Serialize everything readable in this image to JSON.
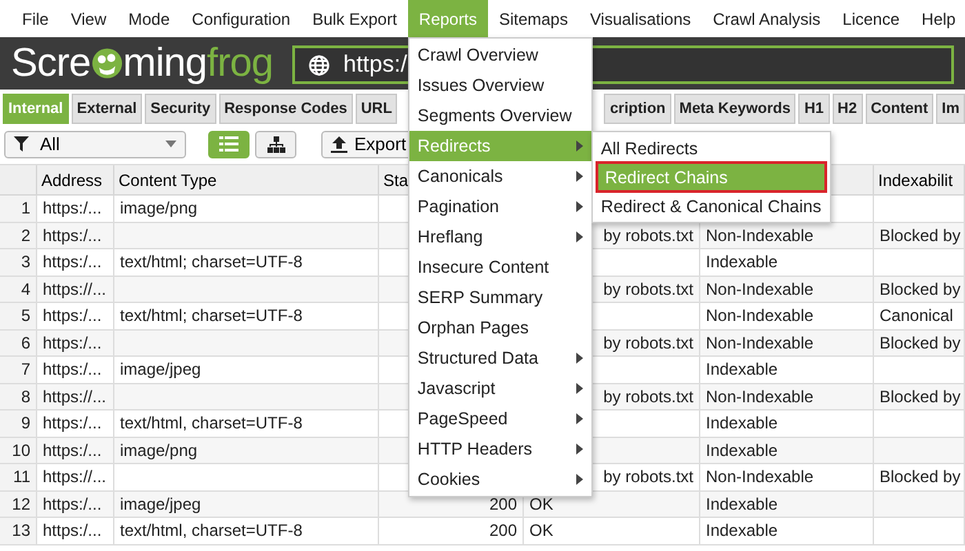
{
  "menu_bar": [
    {
      "label": "File",
      "selected": false
    },
    {
      "label": "View",
      "selected": false
    },
    {
      "label": "Mode",
      "selected": false
    },
    {
      "label": "Configuration",
      "selected": false
    },
    {
      "label": "Bulk Export",
      "selected": false
    },
    {
      "label": "Reports",
      "selected": true
    },
    {
      "label": "Sitemaps",
      "selected": false
    },
    {
      "label": "Visualisations",
      "selected": false
    },
    {
      "label": "Crawl Analysis",
      "selected": false
    },
    {
      "label": "Licence",
      "selected": false
    },
    {
      "label": "Help",
      "selected": false
    }
  ],
  "logo": {
    "start": "Scre",
    "middle": "ming",
    "end": "frog"
  },
  "url_field": {
    "value": "https:/"
  },
  "tabs_left": [
    {
      "label": "Internal",
      "selected": true
    },
    {
      "label": "External",
      "selected": false
    },
    {
      "label": "Security",
      "selected": false
    },
    {
      "label": "Response Codes",
      "selected": false
    },
    {
      "label": "URL",
      "selected": false
    }
  ],
  "tabs_right": [
    {
      "label": "cription",
      "selected": false
    },
    {
      "label": "Meta Keywords",
      "selected": false
    },
    {
      "label": "H1",
      "selected": false
    },
    {
      "label": "H2",
      "selected": false
    },
    {
      "label": "Content",
      "selected": false
    },
    {
      "label": "Im",
      "selected": false
    }
  ],
  "toolbar": {
    "filter": "All",
    "views": [
      {
        "kind": "list",
        "selected": true
      },
      {
        "kind": "tree",
        "selected": false
      }
    ],
    "export": "Export"
  },
  "table": {
    "columns": [
      "",
      "Address",
      "Content Type",
      "Sta",
      "",
      "",
      "Indexabilit"
    ],
    "rows": [
      [
        "1",
        "https:/...",
        "image/png",
        "",
        "",
        "",
        ""
      ],
      [
        "2",
        "https:/...",
        "",
        "",
        "by robots.txt",
        "Non-Indexable",
        "Blocked by"
      ],
      [
        "3",
        "https:/...",
        "text/html; charset=UTF-8",
        "",
        "",
        "Indexable",
        ""
      ],
      [
        "4",
        "https://...",
        "",
        "",
        "by robots.txt",
        "Non-Indexable",
        "Blocked by"
      ],
      [
        "5",
        "https:/...",
        "text/html; charset=UTF-8",
        "",
        "",
        "Non-Indexable",
        "Canonical"
      ],
      [
        "6",
        "https:/...",
        "",
        "",
        "by robots.txt",
        "Non-Indexable",
        "Blocked by"
      ],
      [
        "7",
        "https:/...",
        "image/jpeg",
        "",
        "",
        "Indexable",
        ""
      ],
      [
        "8",
        "https://...",
        "",
        "",
        "by robots.txt",
        "Non-Indexable",
        "Blocked by"
      ],
      [
        "9",
        "https:/...",
        "text/html, charset=UTF-8",
        "",
        "",
        "Indexable",
        ""
      ],
      [
        "10",
        "https:/...",
        "image/png",
        "",
        "",
        "Indexable",
        ""
      ],
      [
        "11",
        "https://...",
        "",
        "",
        "by robots.txt",
        "Non-Indexable",
        "Blocked by"
      ],
      [
        "12",
        "https:/...",
        "image/jpeg",
        "200",
        "OK",
        "Indexable",
        ""
      ],
      [
        "13",
        "https:/...",
        "text/html, charset=UTF-8",
        "200",
        "OK",
        "Indexable",
        ""
      ]
    ]
  },
  "reports_menu": [
    {
      "label": "Crawl Overview",
      "submenu": false,
      "selected": false
    },
    {
      "label": "Issues Overview",
      "submenu": false,
      "selected": false
    },
    {
      "label": "Segments Overview",
      "submenu": false,
      "selected": false
    },
    {
      "label": "Redirects",
      "submenu": true,
      "selected": true
    },
    {
      "label": "Canonicals",
      "submenu": true,
      "selected": false
    },
    {
      "label": "Pagination",
      "submenu": true,
      "selected": false
    },
    {
      "label": "Hreflang",
      "submenu": true,
      "selected": false
    },
    {
      "label": "Insecure Content",
      "submenu": false,
      "selected": false
    },
    {
      "label": "SERP Summary",
      "submenu": false,
      "selected": false
    },
    {
      "label": "Orphan Pages",
      "submenu": false,
      "selected": false
    },
    {
      "label": "Structured Data",
      "submenu": true,
      "selected": false
    },
    {
      "label": "Javascript",
      "submenu": true,
      "selected": false
    },
    {
      "label": "PageSpeed",
      "submenu": true,
      "selected": false
    },
    {
      "label": "HTTP Headers",
      "submenu": true,
      "selected": false
    },
    {
      "label": "Cookies",
      "submenu": true,
      "selected": false
    }
  ],
  "redirects_submenu": [
    {
      "label": "All Redirects",
      "selected": false,
      "outlined": false
    },
    {
      "label": "Redirect Chains",
      "selected": true,
      "outlined": true
    },
    {
      "label": "Redirect & Canonical Chains",
      "selected": false,
      "outlined": false
    }
  ]
}
